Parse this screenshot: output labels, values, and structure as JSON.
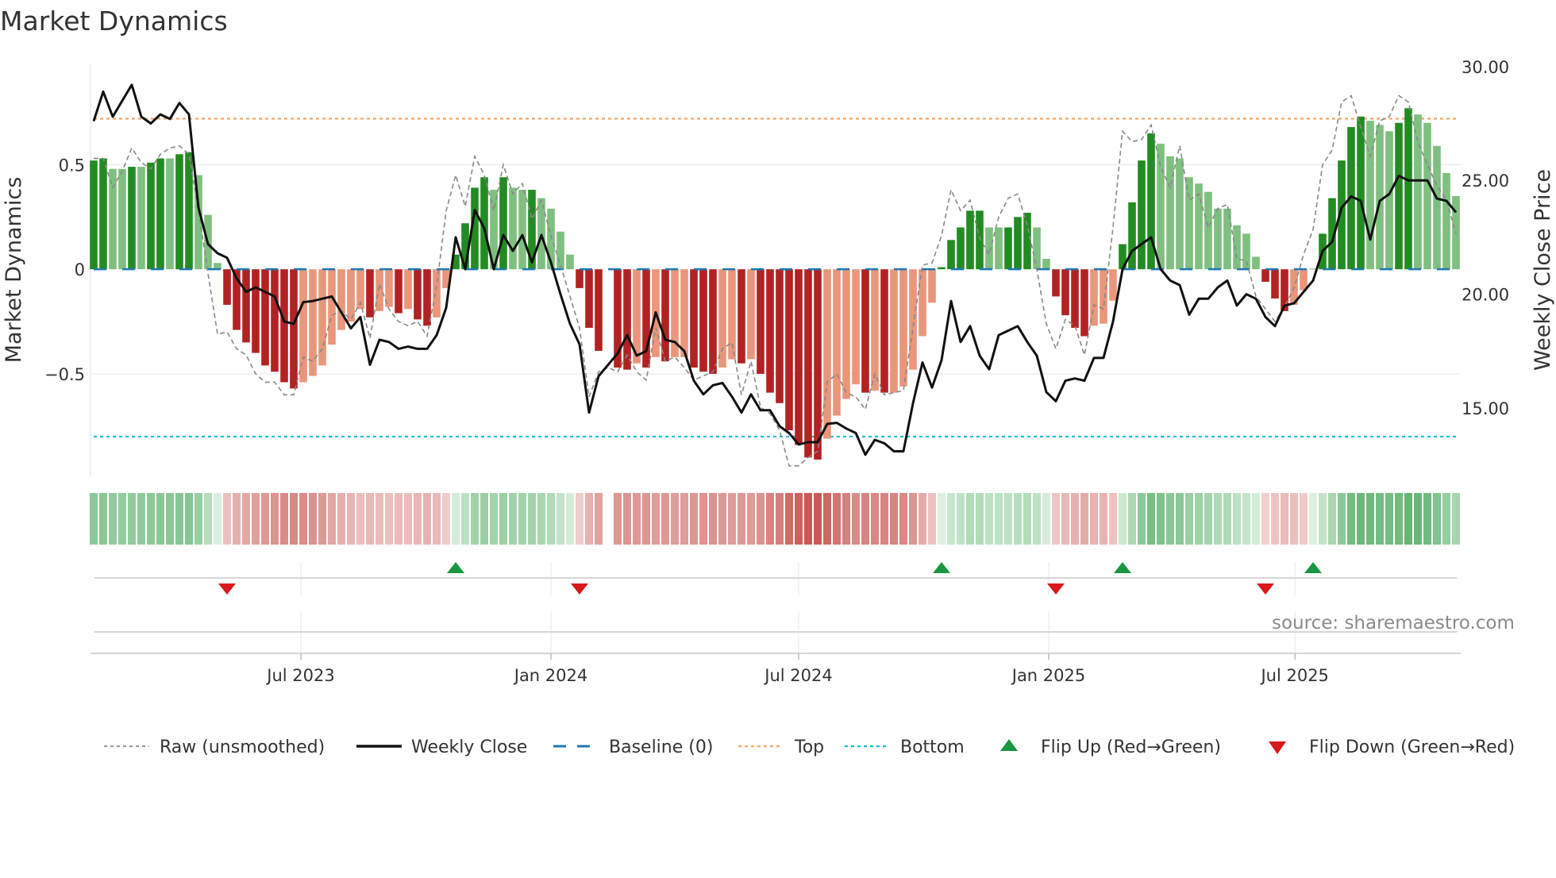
{
  "title": "Market Dynamics",
  "source": "source: sharemaestro.com",
  "colors": {
    "bar_pos_strong": "#228b22",
    "bar_pos_weak": "#7fbf7f",
    "bar_neg_strong": "#b22222",
    "bar_neg_weak": "#e9967a",
    "raw": "#888888",
    "close": "#111111",
    "baseline": "#1f77b4",
    "top": "#f0a868",
    "bottom": "#17becf",
    "flip_up": "#1a9641",
    "flip_down": "#d7191c"
  },
  "chart_data": {
    "type": "bar",
    "title": "Market Dynamics",
    "ylabel": "Market Dynamics",
    "ylabel_right": "Weekly Close Price",
    "ylim": [
      -0.99,
      0.98
    ],
    "ylim_right": [
      12.0,
      30.1
    ],
    "xlim": [
      -0.5,
      143.5
    ],
    "yticks": [
      {
        "v": 0.5,
        "label": "0.5"
      },
      {
        "v": 0,
        "label": "0"
      },
      {
        "v": -0.5,
        "label": "−0.5"
      }
    ],
    "yticks_right": [
      {
        "v": 30,
        "label": "30.00"
      },
      {
        "v": 25,
        "label": "25.00"
      },
      {
        "v": 20,
        "label": "20.00"
      },
      {
        "v": 15,
        "label": "15.00"
      }
    ],
    "xticks": [
      {
        "week": 21.75,
        "label": "Jul 2023"
      },
      {
        "week": 48.0,
        "label": "Jan 2024"
      },
      {
        "week": 74.0,
        "label": "Jul 2024"
      },
      {
        "week": 100.25,
        "label": "Jan 2025"
      },
      {
        "week": 126.1,
        "label": "Jul 2025"
      }
    ],
    "top_level": 0.72,
    "bottom_level": -0.8,
    "baseline": 0,
    "dynamics": [
      0.52,
      0.53,
      0.48,
      0.48,
      0.49,
      0.49,
      0.51,
      0.53,
      0.53,
      0.55,
      0.56,
      0.45,
      0.26,
      0.03,
      -0.17,
      -0.29,
      -0.35,
      -0.4,
      -0.46,
      -0.49,
      -0.54,
      -0.57,
      -0.54,
      -0.51,
      -0.46,
      -0.36,
      -0.29,
      -0.25,
      -0.19,
      -0.23,
      -0.2,
      -0.18,
      -0.21,
      -0.19,
      -0.24,
      -0.27,
      -0.23,
      -0.09,
      0.07,
      0.22,
      0.39,
      0.44,
      0.38,
      0.44,
      0.39,
      0.38,
      0.38,
      0.34,
      0.29,
      0.18,
      0.07,
      -0.09,
      -0.28,
      -0.39,
      null,
      -0.47,
      -0.48,
      -0.45,
      -0.47,
      -0.42,
      -0.44,
      -0.42,
      -0.42,
      -0.47,
      -0.49,
      -0.5,
      -0.47,
      -0.43,
      -0.45,
      -0.43,
      -0.5,
      -0.59,
      -0.64,
      -0.77,
      -0.84,
      -0.9,
      -0.91,
      -0.81,
      -0.7,
      -0.62,
      -0.55,
      -0.59,
      -0.58,
      -0.59,
      -0.59,
      -0.56,
      -0.48,
      -0.32,
      -0.16,
      0.01,
      0.14,
      0.2,
      0.28,
      0.28,
      0.2,
      0.2,
      0.2,
      0.25,
      0.27,
      0.2,
      0.05,
      -0.13,
      -0.22,
      -0.28,
      -0.32,
      -0.27,
      -0.26,
      -0.15,
      0.12,
      0.32,
      0.52,
      0.65,
      0.6,
      0.54,
      0.53,
      0.44,
      0.41,
      0.37,
      0.29,
      0.29,
      0.21,
      0.17,
      0.06,
      -0.06,
      -0.14,
      -0.2,
      -0.17,
      -0.1,
      0.003,
      0.17,
      0.34,
      0.52,
      0.68,
      0.73,
      0.71,
      0.69,
      0.66,
      0.7,
      0.77,
      0.74,
      0.7,
      0.59,
      0.46,
      0.35
    ],
    "strong": [
      1,
      1,
      0,
      0,
      1,
      0,
      1,
      1,
      0,
      1,
      1,
      0,
      0,
      0,
      1,
      1,
      1,
      1,
      1,
      1,
      1,
      1,
      0,
      0,
      0,
      0,
      0,
      0,
      0,
      1,
      0,
      0,
      1,
      0,
      1,
      1,
      0,
      0,
      1,
      1,
      1,
      1,
      0,
      1,
      0,
      0,
      1,
      0,
      0,
      0,
      0,
      1,
      1,
      1,
      0,
      1,
      1,
      0,
      1,
      0,
      1,
      0,
      0,
      1,
      1,
      1,
      0,
      0,
      1,
      0,
      1,
      1,
      1,
      1,
      1,
      1,
      1,
      0,
      0,
      0,
      0,
      1,
      0,
      1,
      0,
      0,
      0,
      0,
      0,
      1,
      1,
      1,
      1,
      1,
      0,
      0,
      1,
      1,
      1,
      0,
      0,
      1,
      1,
      1,
      1,
      0,
      0,
      0,
      1,
      1,
      1,
      1,
      0,
      0,
      0,
      0,
      0,
      0,
      0,
      0,
      0,
      0,
      0,
      1,
      1,
      1,
      0,
      0,
      0,
      1,
      1,
      1,
      1,
      1,
      0,
      0,
      0,
      1,
      1,
      0,
      0,
      0,
      0,
      0
    ],
    "raw": [
      0.53,
      0.53,
      0.39,
      0.47,
      0.58,
      0.51,
      0.48,
      0.55,
      0.58,
      0.59,
      0.55,
      0.28,
      -0.02,
      -0.31,
      -0.3,
      -0.38,
      -0.41,
      -0.5,
      -0.54,
      -0.54,
      -0.6,
      -0.6,
      -0.42,
      -0.44,
      -0.38,
      -0.22,
      -0.2,
      -0.24,
      -0.16,
      -0.33,
      -0.07,
      -0.19,
      -0.25,
      -0.27,
      -0.25,
      -0.32,
      -0.08,
      0.28,
      0.45,
      0.3,
      0.54,
      0.45,
      0.28,
      0.5,
      0.36,
      0.41,
      0.24,
      0.33,
      0.16,
      0.02,
      -0.13,
      -0.28,
      -0.61,
      -0.49,
      -0.47,
      -0.49,
      -0.41,
      -0.49,
      -0.53,
      -0.28,
      -0.44,
      -0.42,
      -0.47,
      -0.53,
      -0.51,
      -0.49,
      -0.38,
      -0.35,
      -0.6,
      -0.44,
      -0.66,
      -0.69,
      -0.77,
      -0.94,
      -0.94,
      -0.9,
      -0.87,
      -0.54,
      -0.5,
      -0.59,
      -0.61,
      -0.67,
      -0.5,
      -0.6,
      -0.59,
      -0.58,
      -0.28,
      0.02,
      0.03,
      0.16,
      0.38,
      0.28,
      0.33,
      0.15,
      0.07,
      0.25,
      0.34,
      0.36,
      0.21,
      0.0,
      -0.26,
      -0.38,
      -0.24,
      -0.27,
      -0.41,
      -0.17,
      -0.19,
      0.2,
      0.66,
      0.61,
      0.62,
      0.69,
      0.49,
      0.39,
      0.59,
      0.33,
      0.36,
      0.2,
      0.29,
      0.31,
      0.05,
      0.04,
      -0.13,
      -0.19,
      -0.25,
      -0.18,
      -0.09,
      0.07,
      0.19,
      0.5,
      0.57,
      0.8,
      0.83,
      0.68,
      0.54,
      0.71,
      0.73,
      0.83,
      0.8,
      0.61,
      0.5,
      0.4,
      0.33,
      0.17
    ],
    "weekly_close": [
      27.6,
      28.9,
      27.8,
      28.5,
      29.2,
      27.8,
      27.5,
      27.9,
      27.7,
      28.4,
      27.9,
      23.8,
      22.2,
      21.8,
      21.6,
      20.7,
      20.1,
      20.3,
      20.1,
      19.9,
      18.8,
      18.7,
      19.65,
      19.7,
      19.8,
      19.9,
      19.2,
      18.5,
      19.0,
      16.9,
      18.0,
      17.9,
      17.6,
      17.7,
      17.6,
      17.6,
      18.2,
      19.4,
      22.5,
      21.1,
      23.7,
      22.9,
      21.1,
      22.6,
      21.9,
      22.6,
      21.4,
      22.6,
      21.4,
      20.0,
      18.7,
      17.8,
      14.8,
      16.4,
      16.9,
      17.4,
      18.2,
      17.3,
      17.5,
      19.2,
      18.0,
      17.9,
      17.5,
      16.2,
      15.6,
      16.0,
      16.1,
      15.5,
      14.8,
      15.6,
      14.9,
      14.9,
      14.2,
      13.9,
      13.4,
      13.5,
      13.5,
      14.3,
      14.35,
      14.1,
      13.9,
      12.95,
      13.6,
      13.45,
      13.1,
      13.1,
      15.2,
      17.0,
      15.9,
      17.1,
      19.7,
      17.9,
      18.6,
      17.3,
      16.7,
      18.2,
      18.4,
      18.6,
      17.9,
      17.3,
      15.7,
      15.3,
      16.2,
      16.3,
      16.2,
      17.2,
      17.2,
      18.8,
      21.1,
      21.9,
      22.2,
      22.5,
      21.1,
      20.6,
      20.4,
      19.1,
      19.8,
      19.8,
      20.3,
      20.6,
      19.5,
      20.0,
      19.8,
      19.0,
      18.6,
      19.5,
      19.6,
      20.1,
      20.6,
      21.9,
      22.3,
      23.8,
      24.3,
      24.1,
      22.4,
      24.1,
      24.4,
      25.2,
      25.0,
      25.0,
      25.0,
      24.2,
      24.1,
      23.6
    ],
    "flip_up_weeks": [
      38,
      89,
      108,
      128
    ],
    "flip_down_weeks": [
      14,
      51,
      101,
      123
    ],
    "legend_position": "bottom",
    "legend": {
      "raw": "Raw (unsmoothed)",
      "close": "Weekly Close",
      "baseline": "Baseline (0)",
      "top": "Top",
      "bottom": "Bottom",
      "flip_up": "Flip Up (Red→Green)",
      "flip_down": "Flip Down (Green→Red)"
    }
  }
}
